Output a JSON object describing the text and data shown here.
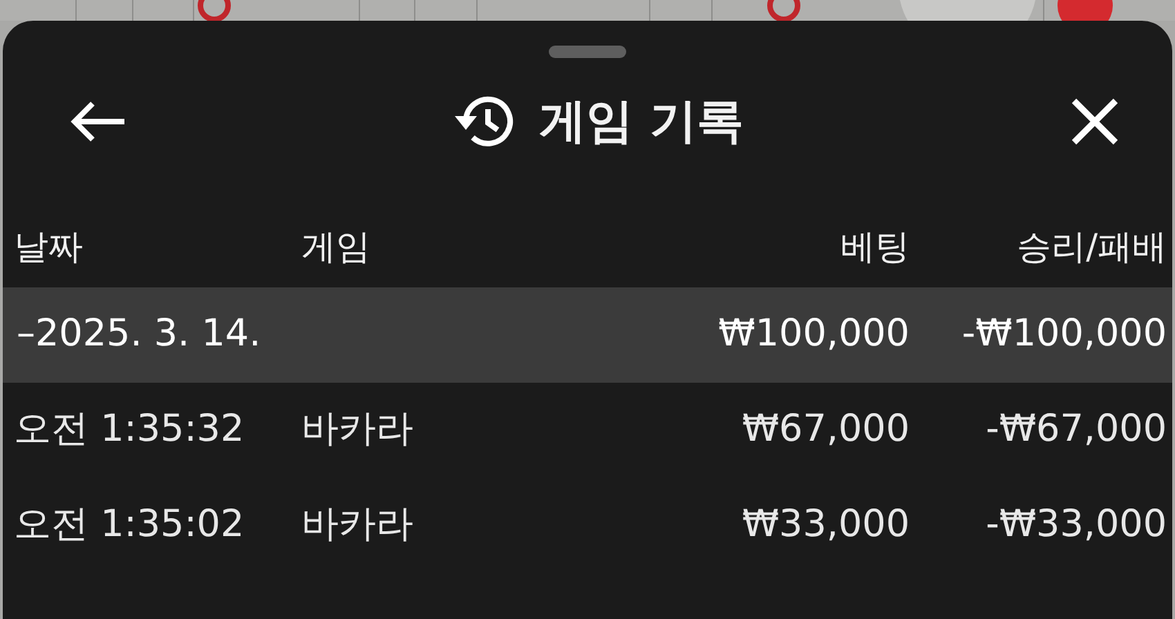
{
  "header": {
    "title": "게임 기록"
  },
  "table": {
    "columns": [
      "날짜",
      "게임",
      "베팅",
      "승리/패배"
    ],
    "group": {
      "date": "–2025. 3. 14.",
      "bet": "₩100,000",
      "result": "-₩100,000",
      "selected": true
    },
    "rows": [
      {
        "time": "오전 1:35:32",
        "game": "바카라",
        "bet": "₩67,000",
        "result": "-₩67,000"
      },
      {
        "time": "오전 1:35:02",
        "game": "바카라",
        "bet": "₩33,000",
        "result": "-₩33,000"
      }
    ]
  }
}
